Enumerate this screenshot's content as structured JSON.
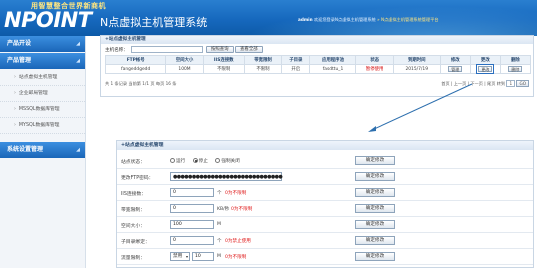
{
  "header": {
    "logo_small": "用智慧整合世界新商机",
    "logo_big": "NPOINT",
    "system_title": "N点虚拟主机管理系统",
    "welcome_user": "admin",
    "welcome_text": "欢迎您登录N点虚拟主机管理系统",
    "breadcrumb": "» N点虚拟主机管理系统管理平台"
  },
  "sidebar": {
    "sections": [
      {
        "label": "产品开设",
        "arrow": "◢"
      },
      {
        "label": "产品管理",
        "arrow": "◢"
      },
      {
        "label": "系统设置管理",
        "arrow": "◢"
      }
    ],
    "items": [
      "站点虚拟主机管理",
      "企业邮局管理",
      "MSSQL数据库管理",
      "MYSQL数据库管理"
    ]
  },
  "list_panel": {
    "title": "+站点虚拟主机管理",
    "search_label": "主机名称：",
    "search_value": "",
    "query_button": "按照查询",
    "all_button": "查看全部",
    "columns": [
      "FTP帐号",
      "空间大小",
      "IIS连接数",
      "带宽限制",
      "子目录",
      "应用程序池",
      "状态",
      "到期时间",
      "修改",
      "更改",
      "删除"
    ],
    "rows": [
      {
        "ftp": "fangeddgedd",
        "space": "100M",
        "iis": "不限制",
        "bandwidth": "不限制",
        "subdir": "开启",
        "pool": "fasdttu_1",
        "status": "暂停使用",
        "expire": "2015/7/19",
        "manage": "管理",
        "change": "更改",
        "delete": "删除"
      }
    ],
    "pager_info": "共 1 条记录  当前第 1/1 页  每页 16 条",
    "pager_links": "首页 | 上一页 | 下一页 | 尾页  转到",
    "page_select": "1",
    "go_label": "GO"
  },
  "detail_panel": {
    "title": "+站点虚拟主机管理",
    "rows": [
      {
        "label": "站点状态：",
        "type": "radio",
        "options": [
          "运行",
          "停止",
          "强制关闭"
        ],
        "selected": 1,
        "button": "确定修改"
      },
      {
        "label": "更改FTP密码：",
        "type": "password",
        "value": "●●●●●●●●●●●●●●●●●●●●●●●●●●●●●",
        "button": "确定修改"
      },
      {
        "label": "IIS连接数：",
        "type": "text",
        "value": "0",
        "unit": "个",
        "hint": "0为不限制",
        "button": "确定修改"
      },
      {
        "label": "带宽限制：",
        "type": "text",
        "value": "0",
        "unit": "KB/秒",
        "hint": "0为不限制",
        "button": "确定修改"
      },
      {
        "label": "空间大小：",
        "type": "text",
        "value": "100",
        "unit": "M",
        "hint": "",
        "button": "确定修改"
      },
      {
        "label": "子目录绑定：",
        "type": "text",
        "value": "0",
        "unit": "个",
        "hint": "0为禁止使用",
        "button": "确定修改"
      },
      {
        "label": "流量限制：",
        "type": "select-text",
        "select_value": "禁用",
        "value": "10",
        "unit": "M",
        "hint": "0为不限制",
        "button": "确定修改"
      }
    ]
  }
}
